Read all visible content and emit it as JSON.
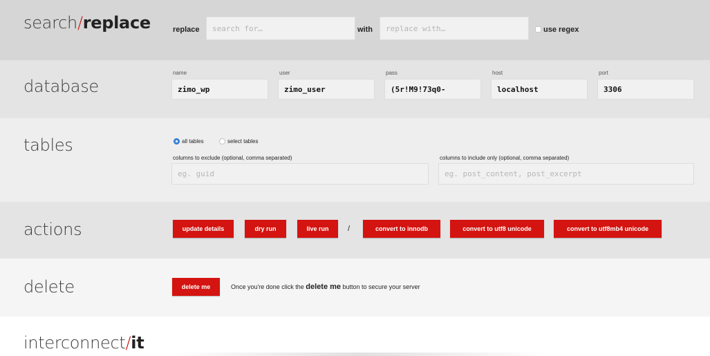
{
  "search_replace": {
    "title_part1": "search",
    "title_slash": "/",
    "title_part2": "replace",
    "replace_label": "replace",
    "search_placeholder": "search for…",
    "with_label": "with",
    "replace_placeholder": "replace with…",
    "regex_label": "use regex"
  },
  "database": {
    "title": "database",
    "fields": [
      {
        "label": "name",
        "value": "zimo_wp"
      },
      {
        "label": "user",
        "value": "zimo_user"
      },
      {
        "label": "pass",
        "value": "(5r!M9!73q0-"
      },
      {
        "label": "host",
        "value": "localhost"
      },
      {
        "label": "port",
        "value": "3306"
      }
    ]
  },
  "tables": {
    "title": "tables",
    "radio_all": "all tables",
    "radio_select": "select tables",
    "exclude_label": "columns to exclude (optional, comma separated)",
    "exclude_placeholder": "eg. guid",
    "include_label": "columns to include only (optional, comma separated)",
    "include_placeholder": "eg. post_content, post_excerpt"
  },
  "actions": {
    "title": "actions",
    "update_details": "update details",
    "dry_run": "dry run",
    "live_run": "live run",
    "separator": "/",
    "convert_innodb": "convert to innodb",
    "convert_utf8": "convert to utf8 unicode",
    "convert_utf8mb4": "convert to utf8mb4 unicode"
  },
  "delete": {
    "title": "delete",
    "button": "delete me",
    "text_before": "Once you're done click the ",
    "text_bold": "delete me",
    "text_after": " button to secure your server"
  },
  "footer": {
    "brand_part1": "interconnect",
    "brand_slash": "/",
    "brand_part2": "it"
  },
  "colors": {
    "accent": "#d31410",
    "band_dark": "#d6d6d6",
    "band_mid": "#e4e4e4",
    "band_light": "#eeeeee",
    "band_lighter": "#f5f5f5"
  }
}
